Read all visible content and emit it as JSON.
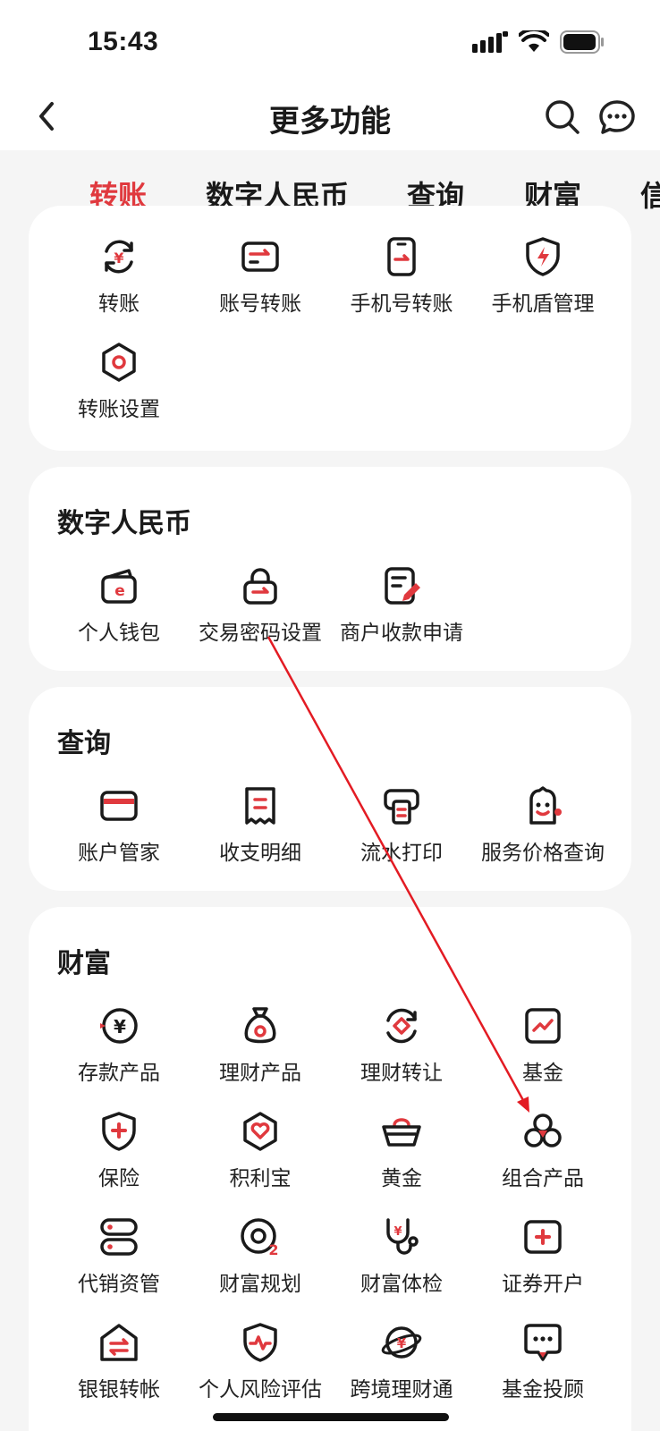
{
  "status": {
    "time": "15:43"
  },
  "nav": {
    "title": "更多功能"
  },
  "tabs": [
    {
      "label": "转账",
      "active": true
    },
    {
      "label": "数字人民币",
      "active": false
    },
    {
      "label": "查询",
      "active": false
    },
    {
      "label": "财富",
      "active": false
    },
    {
      "label": "信",
      "active": false
    }
  ],
  "sections": {
    "transfer": {
      "items": [
        {
          "label": "转账",
          "icon": "yuan-transfer-icon"
        },
        {
          "label": "账号转账",
          "icon": "card-transfer-icon"
        },
        {
          "label": "手机号转账",
          "icon": "phone-transfer-icon"
        },
        {
          "label": "手机盾管理",
          "icon": "shield-bolt-icon"
        },
        {
          "label": "转账设置",
          "icon": "hexagon-settings-icon"
        }
      ]
    },
    "ecny": {
      "title": "数字人民币",
      "items": [
        {
          "label": "个人钱包",
          "icon": "wallet-icon"
        },
        {
          "label": "交易密码设置",
          "icon": "lock-icon"
        },
        {
          "label": "商户收款申请",
          "icon": "form-edit-icon"
        }
      ]
    },
    "query": {
      "title": "查询",
      "items": [
        {
          "label": "账户管家",
          "icon": "card-icon"
        },
        {
          "label": "收支明细",
          "icon": "receipt-icon"
        },
        {
          "label": "流水打印",
          "icon": "printer-icon"
        },
        {
          "label": "服务价格查询",
          "icon": "service-face-icon"
        }
      ]
    },
    "wealth": {
      "title": "财富",
      "items": [
        {
          "label": "存款产品",
          "icon": "yuan-coin-icon"
        },
        {
          "label": "理财产品",
          "icon": "money-bag-icon"
        },
        {
          "label": "理财转让",
          "icon": "exchange-icon"
        },
        {
          "label": "基金",
          "icon": "chart-icon"
        },
        {
          "label": "保险",
          "icon": "shield-plus-icon"
        },
        {
          "label": "积利宝",
          "icon": "hexagon-heart-icon"
        },
        {
          "label": "黄金",
          "icon": "gold-ingot-icon"
        },
        {
          "label": "组合产品",
          "icon": "portfolio-icon"
        },
        {
          "label": "代销资管",
          "icon": "server-icon"
        },
        {
          "label": "财富规划",
          "icon": "plan-icon"
        },
        {
          "label": "财富体检",
          "icon": "stethoscope-icon"
        },
        {
          "label": "证券开户",
          "icon": "securities-icon"
        },
        {
          "label": "银银转帐",
          "icon": "bank-transfer-icon"
        },
        {
          "label": "个人风险评估",
          "icon": "shield-pulse-icon"
        },
        {
          "label": "跨境理财通",
          "icon": "globe-yuan-icon"
        },
        {
          "label": "基金投顾",
          "icon": "chat-advisor-icon"
        }
      ]
    }
  },
  "colors": {
    "accent": "#e0393e",
    "ink": "#1a1a1a",
    "background": "#f5f5f5"
  }
}
